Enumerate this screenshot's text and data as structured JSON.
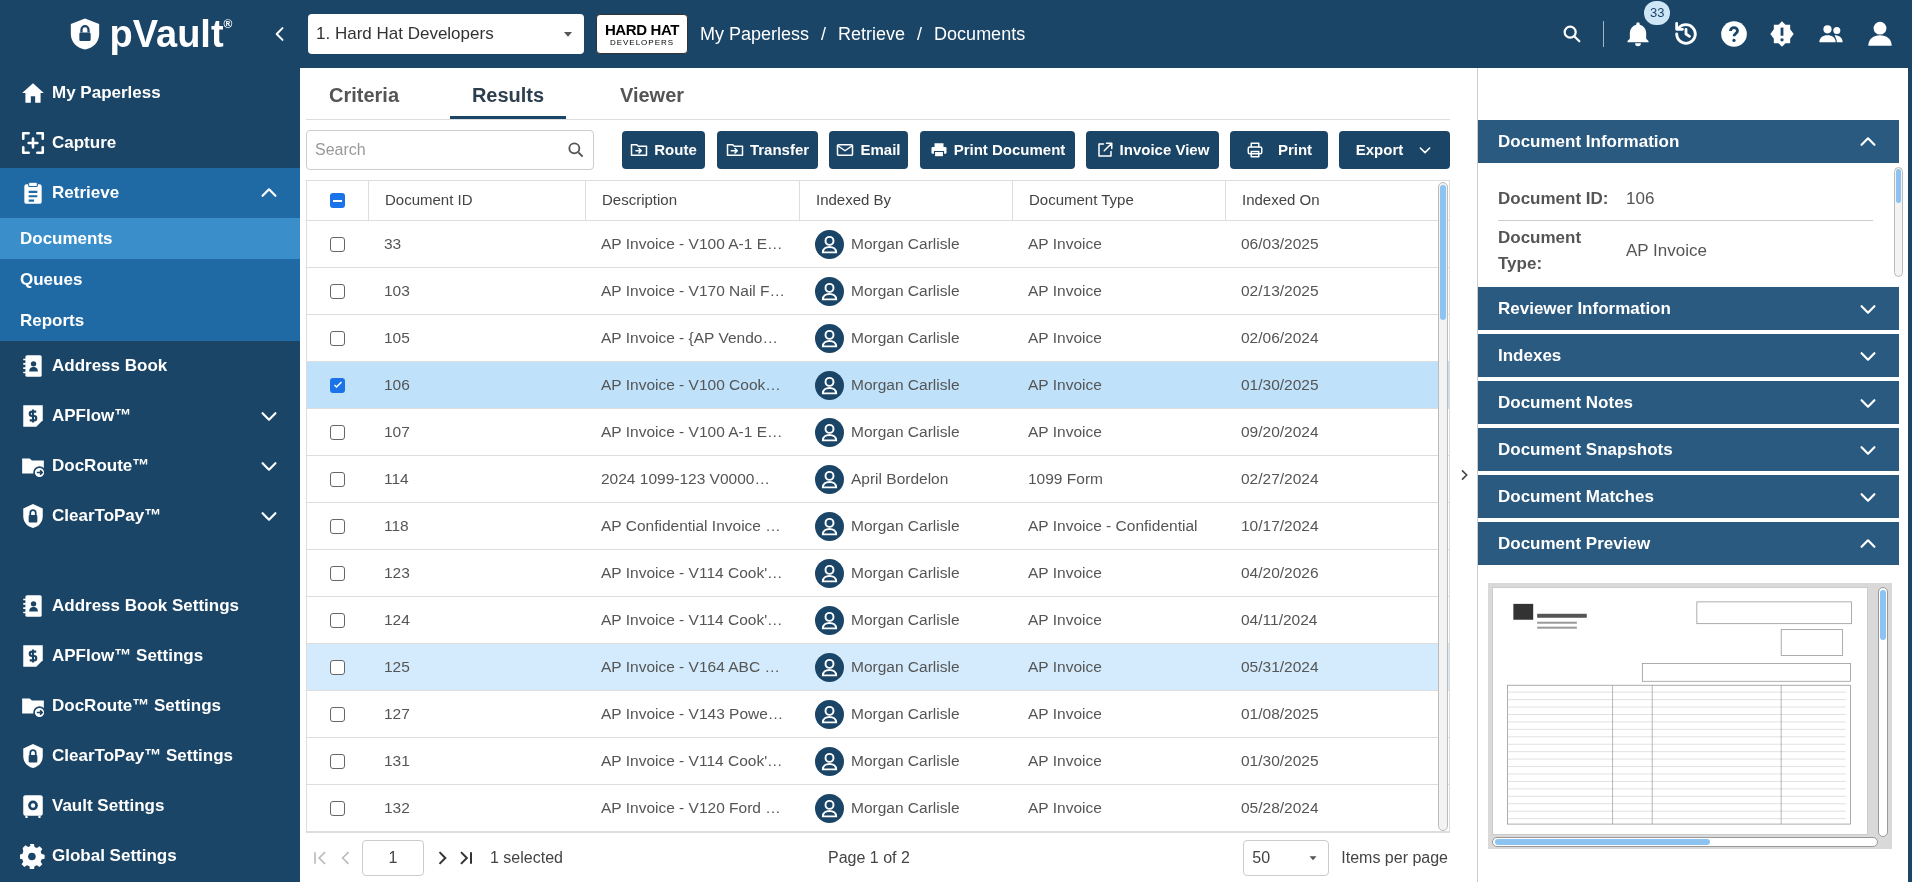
{
  "header": {
    "logo": "pVault$^{®}$",
    "company_select": "1. Hard Hat Developers",
    "brand_logo": {
      "top": "HARD HAT",
      "bottom": "DEVELOPERS"
    },
    "breadcrumb": [
      {
        "label": "My Paperless"
      },
      {
        "separator": "/",
        "label": "Retrieve"
      },
      {
        "separator": "/",
        "label": "Documents"
      }
    ],
    "notification_count": "33"
  },
  "sidebar": {
    "items": [
      {
        "label": "My Paperless",
        "selected": false
      },
      {
        "label": "Capture",
        "selected": false
      },
      {
        "label": "Retrieve",
        "selected": true,
        "expanded": true,
        "children": [
          {
            "label": "Documents",
            "selected": true
          },
          {
            "label": "Queues",
            "selected": false
          },
          {
            "label": "Reports",
            "selected": false
          }
        ]
      },
      {
        "label": "Address Book",
        "selected": false
      },
      {
        "label": "APFlow™",
        "selected": false,
        "expanded": false
      },
      {
        "label": "DocRoute™",
        "selected": false,
        "expanded": false
      },
      {
        "label": "ClearToPay™",
        "selected": false,
        "expanded": false
      }
    ],
    "settings_items": [
      {
        "label": "Address Book Settings",
        "selected": false
      },
      {
        "label": "APFlow™ Settings",
        "selected": false
      },
      {
        "label": "DocRoute™ Settings",
        "selected": false
      },
      {
        "label": "ClearToPay™ Settings",
        "selected": false
      },
      {
        "label": "Vault Settings",
        "selected": false
      },
      {
        "label": "Global Settings",
        "selected": false
      }
    ]
  },
  "tabs": [
    {
      "label": "Criteria",
      "selected": false
    },
    {
      "label": "Results",
      "selected": true
    },
    {
      "label": "Viewer",
      "selected": false
    }
  ],
  "search": {
    "placeholder": "Search"
  },
  "toolbar": [
    "Route",
    "Transfer",
    "Email",
    "Print Document",
    "Invoice View",
    "Print",
    "Export"
  ],
  "table": {
    "select_all": {
      "indeterminate": true
    },
    "columns": [
      "Document ID",
      "Description",
      "Indexed By",
      "Document Type",
      "Indexed On"
    ],
    "rows": [
      {
        "id": "33",
        "description": "AP Invoice - V100 A-1 E…",
        "indexed_by": "Morgan Carlisle",
        "document_type": "AP Invoice",
        "indexed_on": "06/03/2025",
        "checked": false,
        "highlighted": false
      },
      {
        "id": "103",
        "description": "AP Invoice - V170 Nail F…",
        "indexed_by": "Morgan Carlisle",
        "document_type": "AP Invoice",
        "indexed_on": "02/13/2025",
        "checked": false,
        "highlighted": false
      },
      {
        "id": "105",
        "description": "AP Invoice - {AP Vendo…",
        "indexed_by": "Morgan Carlisle",
        "document_type": "AP Invoice",
        "indexed_on": "02/06/2024",
        "checked": false,
        "highlighted": false
      },
      {
        "id": "106",
        "description": "AP Invoice - V100 Cook…",
        "indexed_by": "Morgan Carlisle",
        "document_type": "AP Invoice",
        "indexed_on": "01/30/2025",
        "checked": true,
        "highlighted": false
      },
      {
        "id": "107",
        "description": "AP Invoice - V100 A-1 E…",
        "indexed_by": "Morgan Carlisle",
        "document_type": "AP Invoice",
        "indexed_on": "09/20/2024",
        "checked": false,
        "highlighted": false
      },
      {
        "id": "114",
        "description": "2024 1099-123 V0000…",
        "indexed_by": "April Bordelon",
        "document_type": "1099 Form",
        "indexed_on": "02/27/2024",
        "checked": false,
        "highlighted": false
      },
      {
        "id": "118",
        "description": "AP Confidential Invoice …",
        "indexed_by": "Morgan Carlisle",
        "document_type": "AP Invoice - Confidential",
        "indexed_on": "10/17/2024",
        "checked": false,
        "highlighted": false
      },
      {
        "id": "123",
        "description": "AP Invoice - V114 Cook'…",
        "indexed_by": "Morgan Carlisle",
        "document_type": "AP Invoice",
        "indexed_on": "04/20/2026",
        "checked": false,
        "highlighted": false
      },
      {
        "id": "124",
        "description": "AP Invoice - V114 Cook'…",
        "indexed_by": "Morgan Carlisle",
        "document_type": "AP Invoice",
        "indexed_on": "04/11/2024",
        "checked": false,
        "highlighted": false
      },
      {
        "id": "125",
        "description": "AP Invoice - V164 ABC …",
        "indexed_by": "Morgan Carlisle",
        "document_type": "AP Invoice",
        "indexed_on": "05/31/2024",
        "checked": false,
        "highlighted": true
      },
      {
        "id": "127",
        "description": "AP Invoice - V143 Powe…",
        "indexed_by": "Morgan Carlisle",
        "document_type": "AP Invoice",
        "indexed_on": "01/08/2025",
        "checked": false,
        "highlighted": false
      },
      {
        "id": "131",
        "description": "AP Invoice - V114 Cook'…",
        "indexed_by": "Morgan Carlisle",
        "document_type": "AP Invoice",
        "indexed_on": "01/30/2025",
        "checked": false,
        "highlighted": false
      },
      {
        "id": "132",
        "description": "AP Invoice - V120 Ford …",
        "indexed_by": "Morgan Carlisle",
        "document_type": "AP Invoice",
        "indexed_on": "05/28/2024",
        "checked": false,
        "highlighted": false
      }
    ]
  },
  "pagination": {
    "page": "1",
    "selected_count": "1 selected",
    "page_info": "Page 1 of 2",
    "per_page": "50",
    "per_page_label": "Items per page"
  },
  "details_panel": {
    "sections": [
      {
        "title": "Document Information",
        "expanded": true,
        "kind": "fields",
        "fields": [
          {
            "label": "Document ID:",
            "value": "106"
          },
          {
            "label": "Document Type:",
            "value": "AP Invoice"
          }
        ]
      },
      {
        "title": "Reviewer Information",
        "expanded": false
      },
      {
        "title": "Indexes",
        "expanded": false
      },
      {
        "title": "Document Notes",
        "expanded": false
      },
      {
        "title": "Document Snapshots",
        "expanded": false
      },
      {
        "title": "Document Matches",
        "expanded": false
      },
      {
        "title": "Document Preview",
        "expanded": true,
        "kind": "preview"
      }
    ]
  }
}
